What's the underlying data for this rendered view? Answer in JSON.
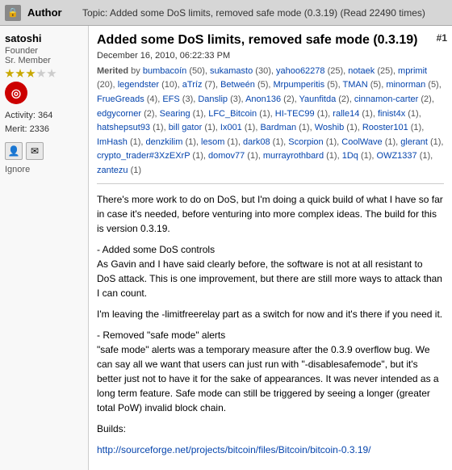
{
  "header": {
    "icon_label": "🔒",
    "author_label": "Author",
    "topic_text": "Topic: Added some DoS limits, removed safe mode (0.3.19)  (Read 22490\ntimes)"
  },
  "user": {
    "username": "satoshi",
    "rank1": "Founder",
    "rank2": "Sr. Member",
    "avatar_letter": "◎",
    "activity_label": "Activity:",
    "activity_value": "364",
    "merit_label": "Merit:",
    "merit_value": "2336",
    "ignore_label": "Ignore"
  },
  "post": {
    "title": "Added some DoS limits, removed safe mode (0.3.19)",
    "date": "December 16, 2010, 06:22:33 PM",
    "number": "#1",
    "merited_line": "Merited by bumbacoín (50), sukamasto (30), yahoo62278 (25), notaek (25), mprimit (20), legendster (10), aTríz (7), Betweén (5), Mrpumperitis (5), TMAN (5), minorman (5), FrueGreads (4), EFS (3), Danslip (3), Anon136 (2), Yaunfitda (2), cinnamon-carter (2), edgycorner (2), Searing (1), LFC_Bitcoin (1), HI-TEC99 (1), ralle14 (1), finist4x (1), hatshepsut93 (1), bill gator (1), Ix001 (1), Bardman (1), Woshib (1), Rooster101 (1), ImHash (1), denzkilim (1), lesom (1), dark08 (1), Scorpion (1), CoolWave (1), glerant (1), crypto_trader#3XzEXrP (1), domov77 (1), murrayrothbard (1), 1Dq (1), OWZ1337 (1), zantezu (1)",
    "body_paragraphs": [
      "There's more work to do on DoS, but I'm doing a quick build of what I have so far in case it's needed, before venturing into more complex ideas.  The build for this is version 0.3.19.",
      "- Added some DoS controls\nAs Gavin and I have said clearly before, the software is not at all resistant to DoS attack.  This is one improvement, but there are still more ways to attack than I can count.",
      "I'm leaving the -limitfreerelay part as a switch for now and it's there if you need it.",
      "- Removed \"safe mode\" alerts\n\"safe mode\" alerts was a temporary measure after the 0.3.9 overflow bug.  We can say all we want that users can just run with \"-disablesafemode\", but it's better just not to have it for the sake of appearances.  It was never intended as a long term feature.  Safe mode can still be triggered by seeing a longer (greater total PoW) invalid block chain.",
      "Builds:",
      "http://sourceforge.net/projects/bitcoin/files/Bitcoin/bitcoin-0.3.19/"
    ]
  }
}
